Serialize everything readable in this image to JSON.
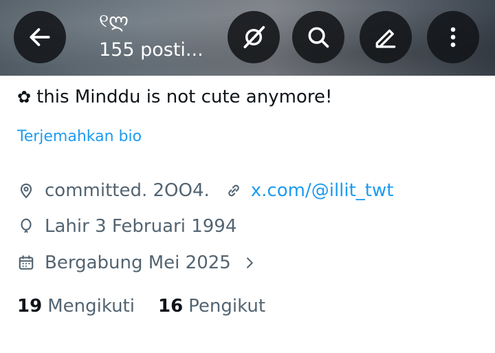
{
  "header": {
    "display_name": "୧ლ",
    "posts_label": "155 posti...",
    "icons": [
      "back-arrow-icon",
      "grok-icon",
      "search-icon",
      "edit-icon",
      "more-vertical-icon"
    ]
  },
  "profile": {
    "bio_emoji": "✿",
    "bio_text": "this Minddu is not cute anymore!",
    "translate_label": "Terjemahkan bio",
    "location": "committed. 2OO4.",
    "website": "x.com/@illit_twt",
    "birth": "Lahir 3 Februari 1994",
    "joined": "Bergabung Mei 2025"
  },
  "stats": {
    "following_count": "19",
    "following_label": "Mengikuti",
    "followers_count": "16",
    "followers_label": "Pengikut"
  },
  "colors": {
    "accent": "#1d9bf0",
    "primary_text": "#0f1419",
    "secondary_text": "#536471",
    "header_button": "#121418"
  }
}
